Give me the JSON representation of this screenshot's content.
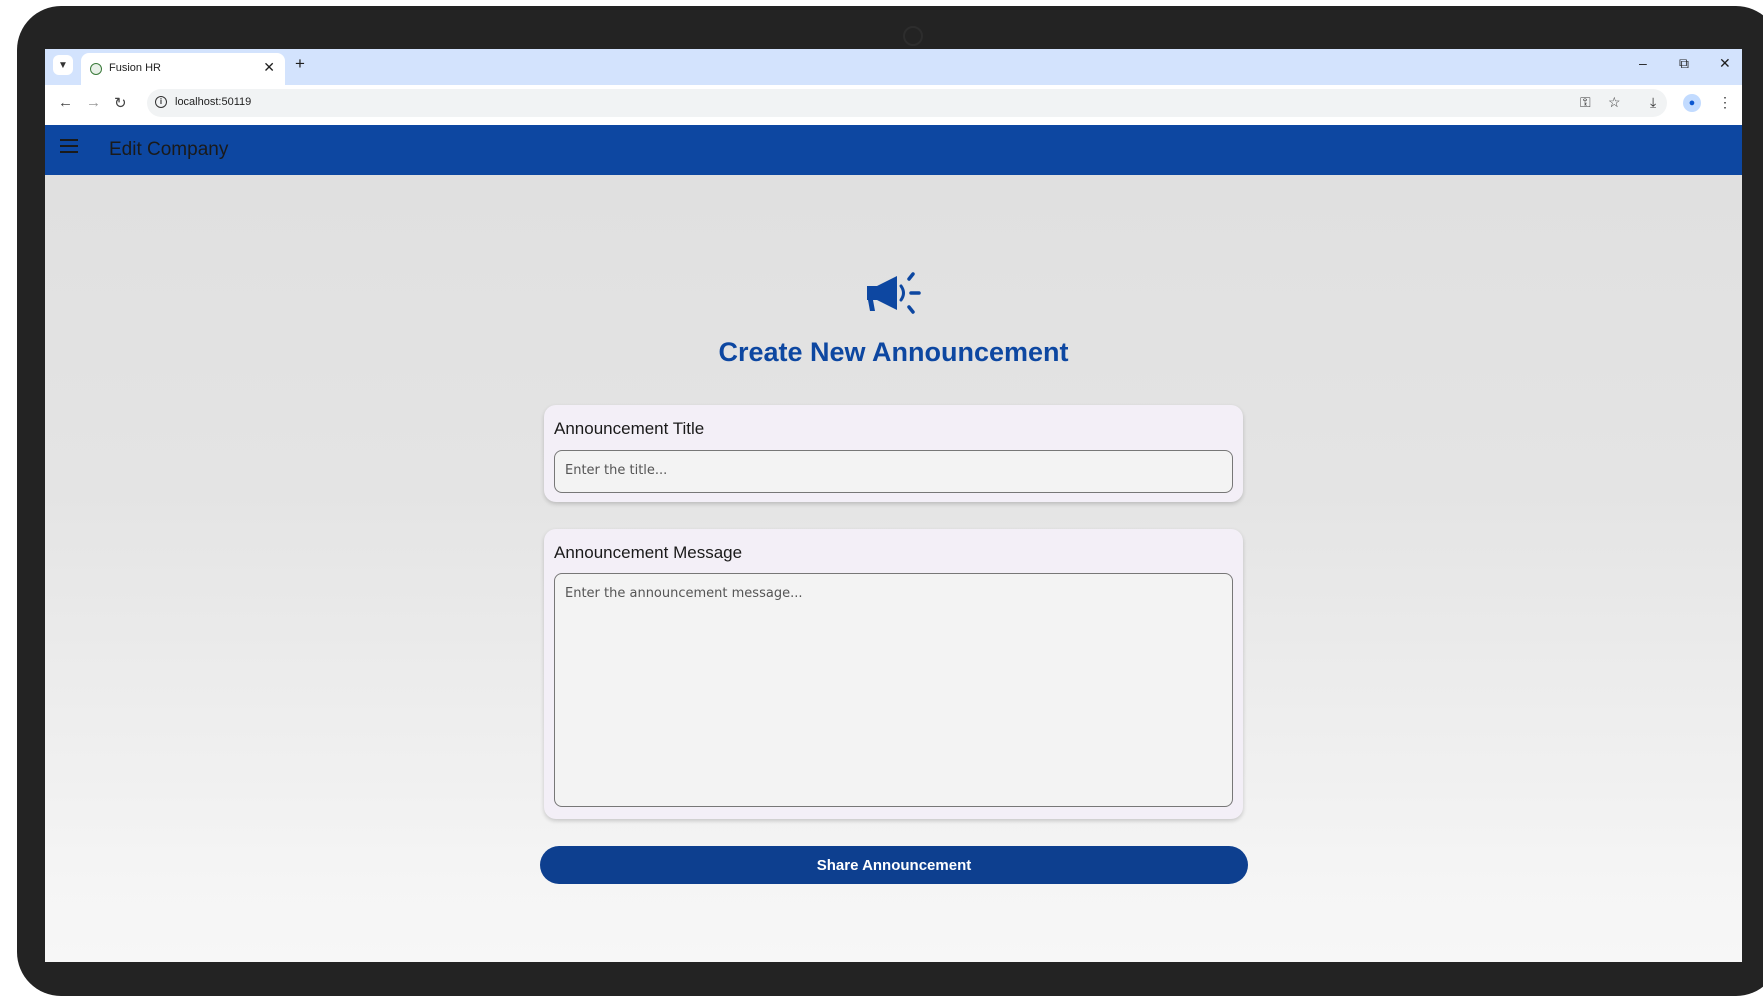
{
  "browser": {
    "tab_title": "Fusion HR",
    "tab_close": "✕",
    "new_tab": "+",
    "url": "localhost:50119",
    "window_controls": {
      "minimize": "–",
      "restore": "⧉",
      "close": "✕"
    },
    "nav": {
      "back": "←",
      "forward": "→",
      "reload": "↻"
    },
    "tools": {
      "passwords": "⚿",
      "bookmark": "☆",
      "download": "⤓",
      "menu": "⋮"
    }
  },
  "appbar": {
    "title": "Edit Company"
  },
  "page": {
    "heading": "Create New Announcement",
    "title_card": {
      "label": "Announcement Title",
      "placeholder": "Enter the title..."
    },
    "message_card": {
      "label": "Announcement Message",
      "placeholder": "Enter the announcement message..."
    },
    "share_button": "Share Announcement"
  },
  "colors": {
    "primary": "#0d47a1",
    "button": "#0d3f8f",
    "card_bg": "#f3eff7",
    "tabstrip": "#d3e3fd"
  }
}
